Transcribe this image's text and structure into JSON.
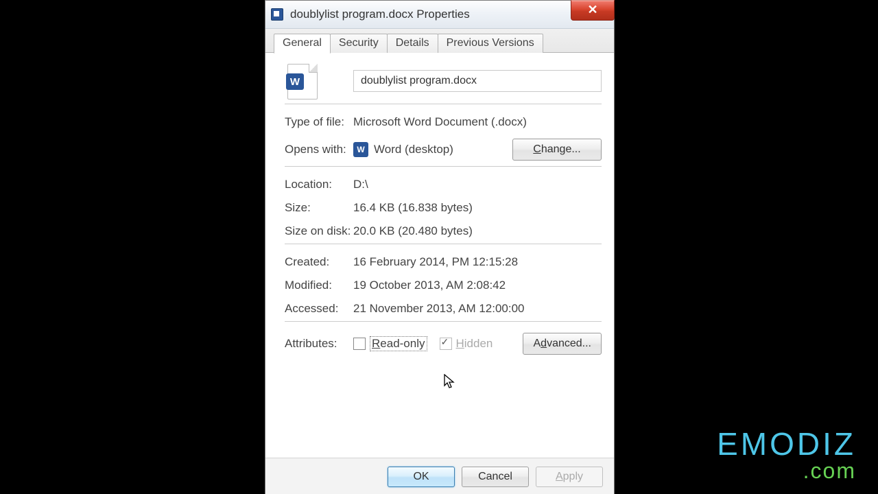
{
  "titlebar": {
    "title": "doublylist program.docx Properties"
  },
  "tabs": [
    "General",
    "Security",
    "Details",
    "Previous Versions"
  ],
  "active_tab": 0,
  "general": {
    "filename": "doublylist program.docx",
    "type_label": "Type of file:",
    "type_value": "Microsoft Word Document (.docx)",
    "opens_label": "Opens with:",
    "opens_value": "Word (desktop)",
    "change_btn": "Change...",
    "location_label": "Location:",
    "location_value": "D:\\",
    "size_label": "Size:",
    "size_value": "16.4 KB (16.838 bytes)",
    "size_on_disk_label": "Size on disk:",
    "size_on_disk_value": "20.0 KB (20.480 bytes)",
    "created_label": "Created:",
    "created_value": "16 February 2014, PM 12:15:28",
    "modified_label": "Modified:",
    "modified_value": "19 October 2013, AM 2:08:42",
    "accessed_label": "Accessed:",
    "accessed_value": "21 November 2013, AM 12:00:00",
    "attributes_label": "Attributes:",
    "readonly_label": "Read-only",
    "hidden_label": "Hidden",
    "advanced_btn": "Advanced..."
  },
  "footer": {
    "ok": "OK",
    "cancel": "Cancel",
    "apply": "Apply"
  },
  "watermark": {
    "line1": "EMODIZ",
    "line2": ".com"
  }
}
